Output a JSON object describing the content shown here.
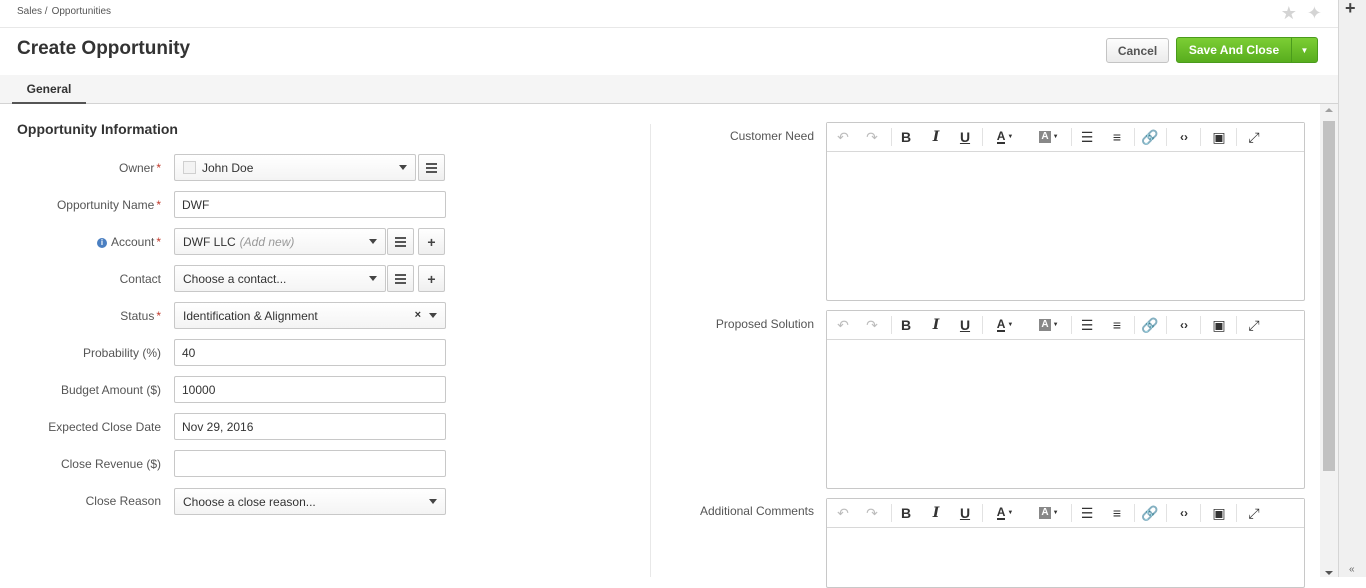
{
  "breadcrumb": [
    "Sales /",
    "Opportunities"
  ],
  "page": {
    "title": "Create Opportunity"
  },
  "actions": {
    "cancel": "Cancel",
    "save": "Save And Close"
  },
  "tabs": [
    "General"
  ],
  "section": {
    "title": "Opportunity Information"
  },
  "fields": {
    "owner": {
      "label": "Owner",
      "value": "John Doe"
    },
    "name": {
      "label": "Opportunity Name",
      "value": "DWF"
    },
    "account": {
      "label": "Account",
      "value": "DWF LLC",
      "hint": "(Add new)"
    },
    "contact": {
      "label": "Contact",
      "placeholder": "Choose a contact..."
    },
    "status": {
      "label": "Status",
      "value": "Identification & Alignment"
    },
    "probability": {
      "label": "Probability (%)",
      "value": "40"
    },
    "budget": {
      "label": "Budget Amount ($)",
      "value": "10000"
    },
    "close_date": {
      "label": "Expected Close Date",
      "value": "Nov 29, 2016"
    },
    "close_revenue": {
      "label": "Close Revenue ($)",
      "value": ""
    },
    "close_reason": {
      "label": "Close Reason",
      "placeholder": "Choose a close reason..."
    }
  },
  "editors": [
    {
      "label": "Customer Need"
    },
    {
      "label": "Proposed Solution"
    },
    {
      "label": "Additional Comments"
    }
  ],
  "colors": {
    "accent_green": "#66bb28",
    "required": "#c0392b",
    "info": "#4a7fc1"
  }
}
